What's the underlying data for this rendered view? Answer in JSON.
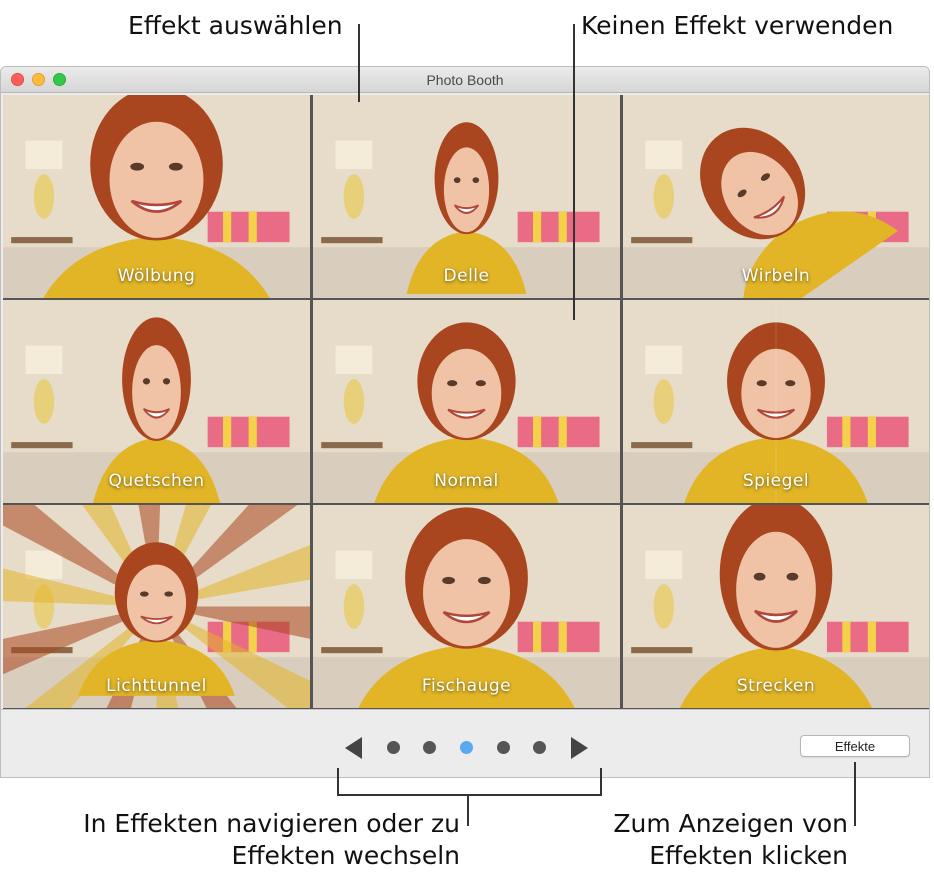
{
  "callouts": {
    "select_effect": "Effekt auswählen",
    "no_effect": "Keinen Effekt verwenden",
    "navigate_line1": "In Effekten navigieren oder zu",
    "navigate_line2": "Effekten wechseln",
    "click_line1": "Zum Anzeigen von",
    "click_line2": "Effekten klicken"
  },
  "window": {
    "title": "Photo Booth"
  },
  "effects": [
    {
      "label": "Wölbung",
      "distortion": "bulge"
    },
    {
      "label": "Delle",
      "distortion": "dent"
    },
    {
      "label": "Wirbeln",
      "distortion": "twirl"
    },
    {
      "label": "Quetschen",
      "distortion": "squeeze"
    },
    {
      "label": "Normal",
      "distortion": "none"
    },
    {
      "label": "Spiegel",
      "distortion": "mirror"
    },
    {
      "label": "Lichttunnel",
      "distortion": "light-tunnel"
    },
    {
      "label": "Fischauge",
      "distortion": "fisheye"
    },
    {
      "label": "Strecken",
      "distortion": "stretch"
    }
  ],
  "pagination": {
    "pages": 5,
    "active_page": 3,
    "prev_icon": "triangle-left-icon",
    "next_icon": "triangle-right-icon"
  },
  "effects_button": {
    "label": "Effekte"
  },
  "colors": {
    "sweater": "#e2b526",
    "hair": "#a9451f",
    "skin": "#f1c3a6",
    "wall": "#e6dcc9",
    "active_dot": "#5aa7f2",
    "close": "#fc605c",
    "minimize": "#fdbc40",
    "zoom": "#34c84a"
  }
}
